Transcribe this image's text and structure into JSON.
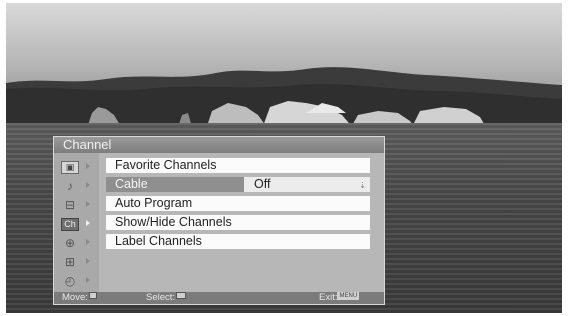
{
  "menu": {
    "title": "Channel",
    "sidebar": [
      {
        "icon": "picture-icon",
        "glyph": "▣",
        "active": false
      },
      {
        "icon": "music-note-icon",
        "glyph": "♪",
        "active": false
      },
      {
        "icon": "screen-icon",
        "glyph": "⊟",
        "active": false
      },
      {
        "icon": "channel-icon",
        "glyph": "Ch",
        "active": true
      },
      {
        "icon": "parental-lock-icon",
        "glyph": "⊕",
        "active": false
      },
      {
        "icon": "toolbox-icon",
        "glyph": "⊞",
        "active": false
      },
      {
        "icon": "clock-icon",
        "glyph": "◴",
        "active": false
      }
    ],
    "items": [
      {
        "label": "Favorite Channels"
      },
      {
        "label": "Cable",
        "value": "Off",
        "selected": true
      },
      {
        "label": "Auto Program"
      },
      {
        "label": "Show/Hide Channels"
      },
      {
        "label": "Label Channels"
      }
    ],
    "footer": {
      "move_label": "Move:",
      "select_label": "Select:",
      "exit_label": "Exit:",
      "exit_key": "MENU"
    }
  }
}
